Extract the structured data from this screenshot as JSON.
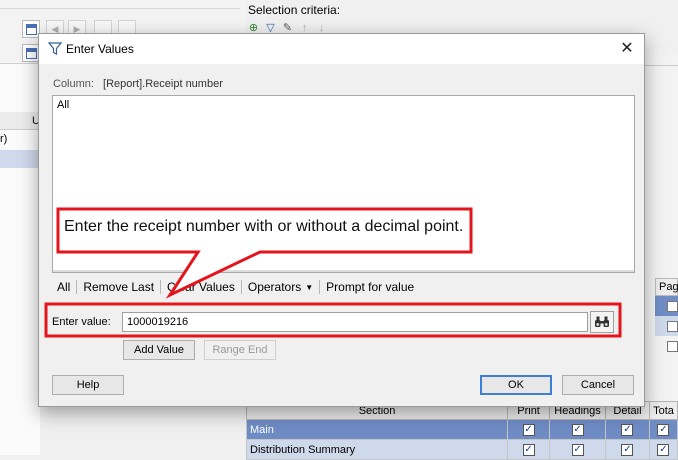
{
  "background": {
    "selection_criteria_label": "Selection criteria:",
    "left_column_header": "U",
    "left_column_text": "r)",
    "pag_header": "Pag",
    "sections_table": {
      "headers": [
        "Section",
        "Print",
        "Headings",
        "Detail",
        "Tota"
      ],
      "rows": [
        {
          "name": "Main",
          "print": true,
          "headings": true,
          "detail": true,
          "total": true
        },
        {
          "name": "Distribution Summary",
          "print": true,
          "headings": true,
          "detail": true,
          "total": true
        }
      ]
    }
  },
  "dialog": {
    "title": "Enter Values",
    "column_label": "Column:",
    "column_value": "[Report].Receipt number",
    "list_items": [
      "All"
    ],
    "actions": [
      "All",
      "Remove Last",
      "Clear Values",
      "Operators",
      "Prompt for value"
    ],
    "enter_value_label": "Enter value:",
    "enter_value": "1000019216",
    "add_value_label": "Add Value",
    "range_end_label": "Range End",
    "help_label": "Help",
    "ok_label": "OK",
    "cancel_label": "Cancel"
  },
  "annotation": {
    "callout_text": "Enter the receipt number with or without a decimal point.",
    "color": "#e3141b"
  },
  "icons": [
    "filter-icon",
    "close-icon",
    "binoculars-icon",
    "dropdown-caret-icon",
    "calendar-icon",
    "checkbox-icon"
  ]
}
